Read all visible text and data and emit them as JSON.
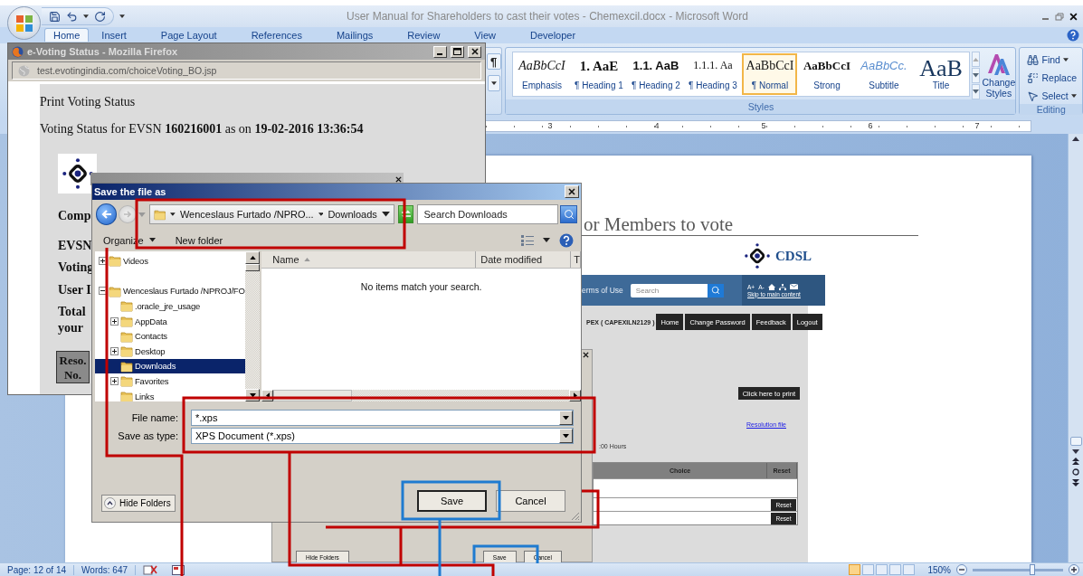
{
  "word": {
    "title": "User Manual for Shareholders to cast their votes - Chemexcil.docx - Microsoft Word",
    "tabs": [
      {
        "label": "Home",
        "selected": true
      },
      {
        "label": "Insert",
        "selected": false
      },
      {
        "label": "Page Layout",
        "selected": false
      },
      {
        "label": "References",
        "selected": false
      },
      {
        "label": "Mailings",
        "selected": false
      },
      {
        "label": "Review",
        "selected": false
      },
      {
        "label": "View",
        "selected": false
      },
      {
        "label": "Developer",
        "selected": false
      }
    ],
    "show_marks": "¶",
    "styles": [
      {
        "kind": "emphasis",
        "sample": "AaBbCcI",
        "label": "Emphasis",
        "selected": false
      },
      {
        "kind": "heading1",
        "sample": "1.  AaE",
        "label": "¶ Heading 1",
        "selected": false
      },
      {
        "kind": "heading2",
        "sample": "1.1.  AaB",
        "label": "¶ Heading 2",
        "selected": false
      },
      {
        "kind": "heading3",
        "sample": "1.1.1.  Aa",
        "label": "¶ Heading 3",
        "selected": false
      },
      {
        "kind": "normal",
        "sample": "AaBbCcI",
        "label": "¶ Normal",
        "selected": true
      },
      {
        "kind": "strong",
        "sample": "AaBbCcI",
        "label": "Strong",
        "selected": false
      },
      {
        "kind": "subtitle",
        "sample": "AaBbCc.",
        "label": "Subtitle",
        "selected": false
      },
      {
        "kind": "title",
        "sample": "AaB",
        "label": "Title",
        "selected": false
      }
    ],
    "change_styles": "Change Styles",
    "styles_group": "Styles",
    "editing": {
      "items": [
        {
          "kind": "find",
          "label": "Find",
          "dropdown": true
        },
        {
          "kind": "replace",
          "label": "Replace",
          "dropdown": false
        },
        {
          "kind": "select",
          "label": "Select",
          "dropdown": true
        }
      ],
      "group": "Editing"
    },
    "ruler": [
      "3",
      "4",
      "5",
      "6",
      "7"
    ],
    "status_bar": {
      "page": "Page: 12 of 14",
      "words": "Words: 647",
      "views": [
        {
          "selected": true
        },
        {
          "selected": false
        },
        {
          "selected": false
        },
        {
          "selected": false
        },
        {
          "selected": false
        }
      ],
      "zoom": "150%",
      "zoom_slider": {
        "level": 0.66
      }
    }
  },
  "document": {
    "heading": "or Members to vote",
    "logo_text": "CDSL",
    "site": {
      "banner_link": "erms of Use",
      "search_placeholder": "Search",
      "font_controls": [
        "A+",
        "A-"
      ],
      "skip_link": "Skip to main content",
      "user": "PEX ( CAPEXILN2129 )",
      "nav": [
        "Home",
        "Change Password",
        "Feedback",
        "Logout"
      ],
      "print": "Click here to print",
      "resolution": "Resolution file",
      "hours": ":00 Hours",
      "columns": [
        "Choice",
        "Reset"
      ],
      "reset_buttons": [
        "Reset",
        "Reset"
      ]
    },
    "embedded_dialog": {
      "hide_folders": "Hide Folders",
      "buttons": [
        "Save",
        "Cancel"
      ]
    }
  },
  "firefox": {
    "title": "e-Voting Status - Mozilla Firefox",
    "url": "test.evotingindia.com/choiceVoting_BO.jsp",
    "heading": "Print Voting Status",
    "status": "Voting Status for EVSN **160216001** as on **19-02-2016 13:36:54**",
    "labels": [
      "Comp",
      "EVSN",
      "Voting",
      "User I",
      "Total",
      "your"
    ],
    "table_header": "Reso. No."
  },
  "save_dialog": {
    "title": "Save the file as",
    "path": [
      "Wenceslaus Furtado /NPRO...",
      "Downloads"
    ],
    "search_placeholder": "Search Downloads",
    "organize": "Organize",
    "new_folder": "New folder",
    "tree": [
      {
        "label": "Videos",
        "kind": "collapsed",
        "selected": false
      },
      {
        "label": "Wenceslaus Furtado /NPROJ/FO",
        "kind": "expanded",
        "selected": false,
        "children": [
          {
            "label": ".oracle_jre_usage",
            "kind": "leaf",
            "selected": false
          },
          {
            "label": "AppData",
            "kind": "collapsed",
            "selected": false
          },
          {
            "label": "Contacts",
            "kind": "leaf",
            "selected": false
          },
          {
            "label": "Desktop",
            "kind": "collapsed",
            "selected": false
          },
          {
            "label": "Downloads",
            "kind": "leaf",
            "selected": true
          },
          {
            "label": "Favorites",
            "kind": "collapsed",
            "selected": false
          },
          {
            "label": "Links",
            "kind": "leaf",
            "selected": false
          }
        ]
      }
    ],
    "columns": [
      "Name",
      "Date modified",
      "T"
    ],
    "empty": "No items match your search.",
    "file_name": {
      "label": "File name:",
      "value": "*.xps"
    },
    "save_as_type": {
      "label": "Save as type:",
      "value": "XPS Document (*.xps)"
    },
    "hide_folders": "Hide Folders",
    "buttons": [
      {
        "label": "Save",
        "default": true
      },
      {
        "label": "Cancel",
        "default": false
      }
    ]
  }
}
